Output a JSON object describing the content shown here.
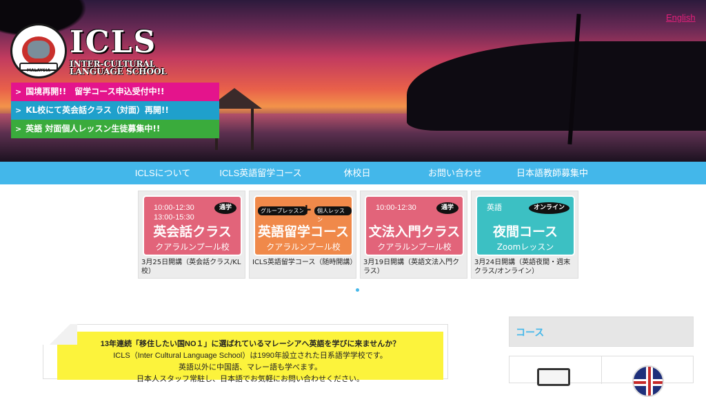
{
  "header": {
    "language_link": "English",
    "logo": {
      "title": "ICLS",
      "subtitle_line1": "INTER-CULTURAL",
      "subtitle_line2": "LANGUAGE SCHOOL",
      "seal_text": "MALAYSIA"
    },
    "notices": [
      {
        "label": "国境再開!!　留学コース申込受付中!!",
        "color": "#e4148c"
      },
      {
        "label": "KL校にて英会話クラス（対面）再開!!",
        "color": "#1fa0cc"
      },
      {
        "label": "英語 対面個人レッスン生徒募集中!!",
        "color": "#3aab3c"
      }
    ]
  },
  "nav": {
    "items": [
      {
        "label": "ICLSについて"
      },
      {
        "label": "ICLS英語留学コース"
      },
      {
        "label": "休校日"
      },
      {
        "label": "お問い合わせ"
      },
      {
        "label": "日本語教師募集中"
      }
    ]
  },
  "courses": [
    {
      "color": "#e2647a",
      "time1": "10:00-12:30",
      "time2": "13:00-15:30",
      "tag": "通学",
      "title": "英会話クラス",
      "place": "クアラルンプール校",
      "caption": "3月25日開講（英会話クラス/KL校）"
    },
    {
      "color": "#f0894a",
      "pill_left": "グループレッスン",
      "pill_right": "個人レッスン",
      "title": "英語留学コース",
      "place": "クアラルンプール校",
      "caption": "ICLS英語留学コース（随時開講）"
    },
    {
      "color": "#e2647a",
      "time1": "10:00-12:30",
      "tag": "通学",
      "title": "文法入門クラス",
      "place": "クアラルンプール校",
      "caption": "3月19日開講（英語文法入門クラス）"
    },
    {
      "color": "#3cc0c3",
      "time1": "英語",
      "tag": "オンライン",
      "title": "夜間コース",
      "place": "Zoomレッスン",
      "caption": "3月24日開講（英語夜間・週末クラス/オンライン）"
    }
  ],
  "welcome": {
    "line1": "13年連続「移住したい国NO１」に選ばれているマレーシアへ英語を学びに来ませんか？",
    "line2": "ICLS（Inter Cultural Language School）は1990年設立された日系語学学校です。",
    "line3": "英語以外に中国語、マレー語も学べます。",
    "line4": "日本人スタッフ常駐し、日本語でお気軽にお問い合わせください。"
  },
  "sidebar": {
    "heading": "コース"
  },
  "colors": {
    "nav": "#43b7ea",
    "accent_link": "#e0207a"
  }
}
